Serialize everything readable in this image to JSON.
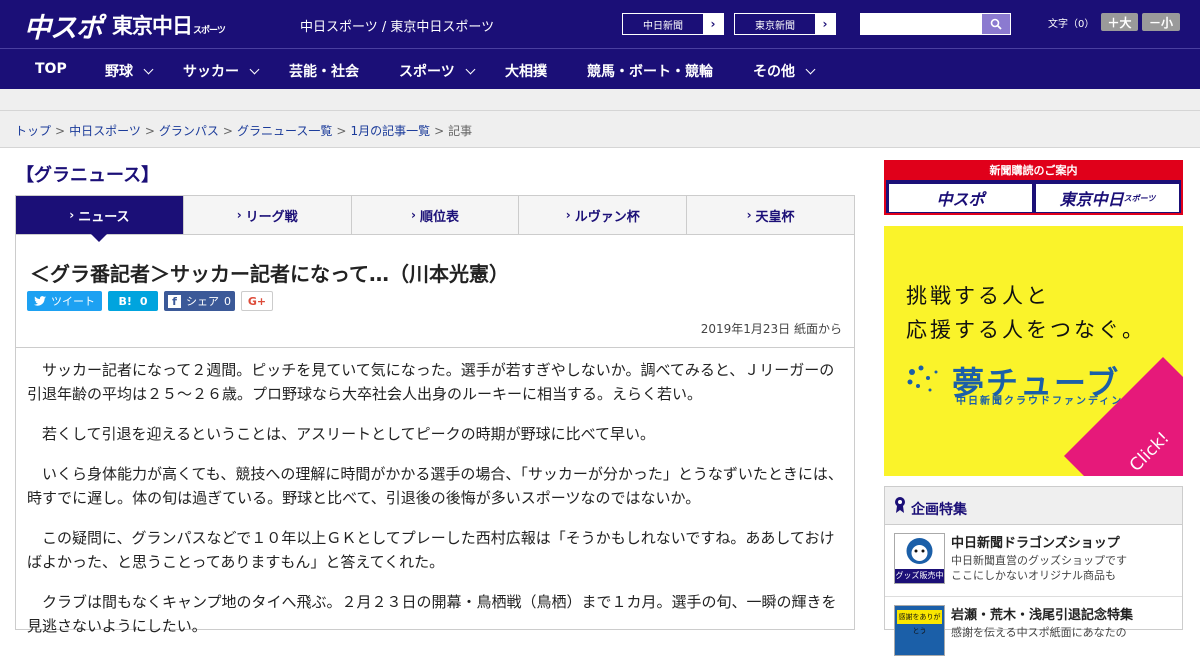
{
  "header": {
    "logo_main": "中スポ",
    "logo_sub": "東京中日",
    "logo_sub_small": "スポーツ",
    "site_names": "中日スポーツ / 東京中日スポーツ",
    "link_chunichi": "中日新聞",
    "link_tokyo": "東京新聞",
    "search_placeholder": "",
    "moji_label": "文字（0）",
    "size_up": "＋大",
    "size_down": "－小"
  },
  "nav": {
    "items": [
      {
        "label": "TOP",
        "has_menu": false
      },
      {
        "label": "野球",
        "has_menu": true
      },
      {
        "label": "サッカー",
        "has_menu": true
      },
      {
        "label": "芸能・社会",
        "has_menu": false
      },
      {
        "label": "スポーツ",
        "has_menu": true
      },
      {
        "label": "大相撲",
        "has_menu": false
      },
      {
        "label": "競馬・ボート・競輪",
        "has_menu": false
      },
      {
        "label": "その他",
        "has_menu": true
      }
    ]
  },
  "breadcrumb": {
    "items": [
      "トップ",
      "中日スポーツ",
      "グランパス",
      "グラニュース一覧",
      "1月の記事一覧"
    ],
    "current": "記事",
    "separator": ">"
  },
  "page_title": "【グラニュース】",
  "tabs": [
    {
      "label": "ニュース",
      "active": true
    },
    {
      "label": "リーグ戦",
      "active": false
    },
    {
      "label": "順位表",
      "active": false
    },
    {
      "label": "ルヴァン杯",
      "active": false
    },
    {
      "label": "天皇杯",
      "active": false
    }
  ],
  "article": {
    "headline": "＜グラ番記者＞サッカー記者になって…（川本光憲）",
    "share": {
      "tweet": "ツイート",
      "hatena_icon": "B!",
      "hatena_count": "0",
      "facebook": "シェア",
      "facebook_count": "0",
      "gplus": "G+"
    },
    "date": "2019年1月23日 紙面から",
    "paragraphs": [
      "サッカー記者になって２週間。ピッチを見ていて気になった。選手が若すぎやしないか。調べてみると、Ｊリーガーの引退年齢の平均は２５～２６歳。プロ野球なら大卒社会人出身のルーキーに相当する。えらく若い。",
      "若くして引退を迎えるということは、アスリートとしてピークの時期が野球に比べて早い。",
      "いくら身体能力が高くても、競技への理解に時間がかかる選手の場合、「サッカーが分かった」とうなずいたときには、時すでに遅し。体の旬は過ぎている。野球と比べて、引退後の後悔が多いスポーツなのではないか。",
      "この疑問に、グランパスなどで１０年以上ＧＫとしてプレーした西村広報は「そうかもしれないですね。ああしておけばよかった、と思うことってありますもん」と答えてくれた。",
      "クラブは間もなくキャンプ地のタイへ飛ぶ。２月２３日の開幕・鳥栖戦（鳥栖）まで１カ月。選手の旬、一瞬の輝きを見逃さないようにしたい。"
    ]
  },
  "sidebar": {
    "subscription": {
      "title": "新聞購読のご案内",
      "btn1": "中スポ",
      "btn2": "東京中日",
      "btn2_small": "スポーツ"
    },
    "ad": {
      "line1": "挑戦する人と",
      "line2": "応援する人をつなぐ。",
      "brand": "夢チューブ",
      "sub": "中日新聞クラウドファンディング",
      "click": "Click!"
    },
    "kikaku": {
      "title": "企画特集",
      "items": [
        {
          "title": "中日新聞ドラゴンズショップ",
          "desc1": "中日新聞直営のグッズショップです",
          "desc2": "ここにしかないオリジナル商品も",
          "thumb_label": "グッズ販売中"
        },
        {
          "title": "岩瀬・荒木・浅尾引退記念特集",
          "desc1": "感謝を伝える中スポ紙面にあなたの",
          "desc2": "",
          "thumb_label": "感謝をありがとう"
        }
      ]
    }
  }
}
